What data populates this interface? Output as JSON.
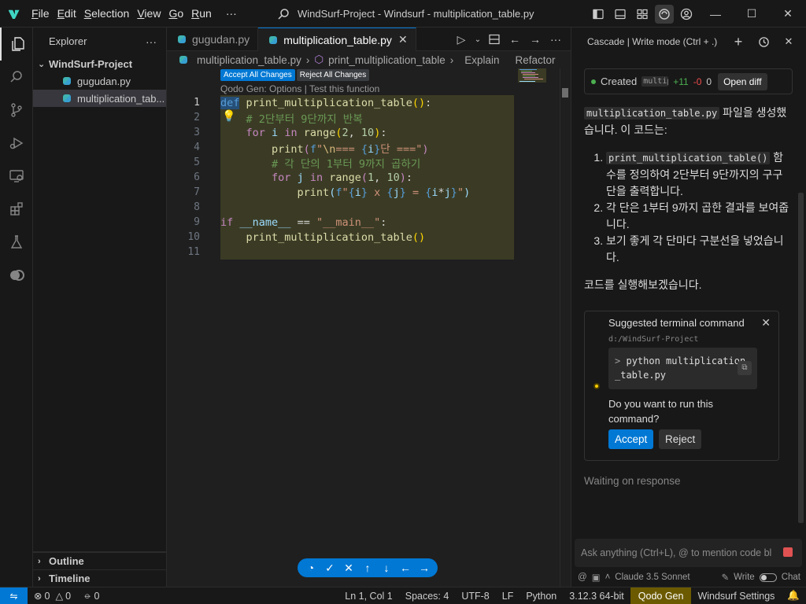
{
  "menu": [
    "File",
    "Edit",
    "Selection",
    "View",
    "Go",
    "Run",
    "···"
  ],
  "window_title": "WindSurf-Project - Windsurf - multiplication_table.py",
  "explorer": {
    "title": "Explorer",
    "folder": "WindSurf-Project",
    "files": [
      "gugudan.py",
      "multiplication_tab..."
    ],
    "outline": "Outline",
    "timeline": "Timeline"
  },
  "tabs": [
    {
      "label": "gugudan.py"
    },
    {
      "label": "multiplication_table.py"
    }
  ],
  "breadcrumb": {
    "file": "multiplication_table.py",
    "symbol": "print_multiplication_table",
    "explain": "Explain",
    "refactor": "Refactor",
    "more": "Ac"
  },
  "code_actions": {
    "accept_all": "Accept All Changes",
    "reject_all": "Reject All Changes",
    "lens": "Qodo Gen: Options | Test this function"
  },
  "code_lines": [
    "1",
    "2",
    "3",
    "4",
    "5",
    "6",
    "7",
    "8",
    "9",
    "10",
    "11"
  ],
  "cascade": {
    "header": "Cascade | Write mode (Ctrl + .)",
    "created_label": "Created",
    "created_file": "multiplication_table.py",
    "added": "+11",
    "removed": "-0",
    "zero": "0",
    "open_diff": "Open diff",
    "msg_file": "multiplication_table.py",
    "msg_intro": " 파일을 생성했습니다. 이 코드는:",
    "list_item1_code": "print_multiplication_table()",
    "list_item1_text": " 함수를 정의하여 2단부터 9단까지의 구구단을 출력합니다.",
    "list_item2": "각 단은 1부터 9까지 곱한 결과를 보여줍니다.",
    "list_item3": "보기 좋게 각 단마다 구분선을 넣었습니다.",
    "run_line": "코드를 실행해보겠습니다.",
    "term_title": "Suggested terminal command",
    "term_path": "d:/WindSurf-Project",
    "term_prompt": ">",
    "term_command": "python multiplication_table.py",
    "term_question": "Do you want to run this command?",
    "accept": "Accept",
    "reject": "Reject",
    "waiting": "Waiting on response",
    "input_placeholder": "Ask anything (Ctrl+L), @ to mention code bl",
    "model": "Claude 3.5 Sonnet",
    "write": "Write",
    "chat": "Chat"
  },
  "statusbar": {
    "errors": "0",
    "warnings": "0",
    "ports": "0",
    "position": "Ln 1, Col 1",
    "spaces": "Spaces: 4",
    "encoding": "UTF-8",
    "eol": "LF",
    "language": "Python",
    "interpreter": "3.12.3 64-bit",
    "qodo": "Qodo Gen",
    "windsurf": "Windsurf Settings"
  },
  "colors": {
    "accent": "#0078d4",
    "diff_add_bg": "#3b3b25",
    "qodo_badge": "#6b5a00"
  }
}
